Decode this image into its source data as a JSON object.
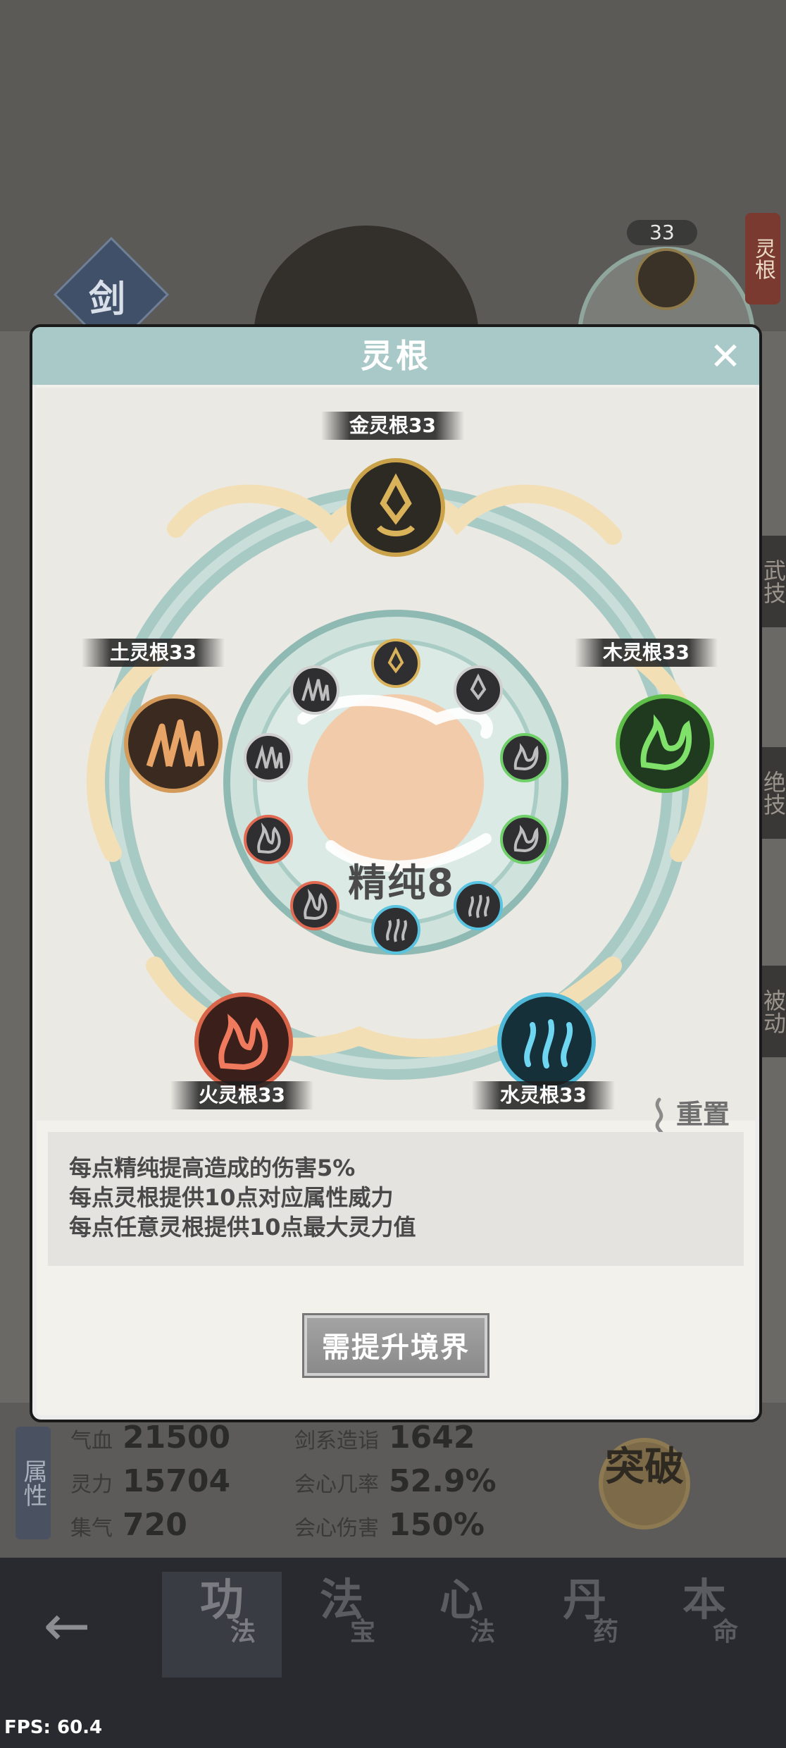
{
  "background": {
    "skill_badge": "剑",
    "level_badge": "33",
    "side_tag": "灵根",
    "side_tabs": [
      "武技",
      "绝技",
      "被动"
    ]
  },
  "modal": {
    "title": "灵根",
    "close_icon": "close-icon",
    "purity_label": "精纯8",
    "roots": {
      "metal": {
        "label": "金灵根33",
        "color": "#c9a24a"
      },
      "wood": {
        "label": "木灵根33",
        "color": "#5fbf4a"
      },
      "water": {
        "label": "水灵根33",
        "color": "#4fb8d6"
      },
      "fire": {
        "label": "火灵根33",
        "color": "#d8644a"
      },
      "earth": {
        "label": "土灵根33",
        "color": "#d39a5a"
      }
    },
    "reset_label": "重置",
    "descriptions": [
      "每点精纯提高造成的伤害5%",
      "每点灵根提供10点对应属性威力",
      "每点任意灵根提供10点最大灵力值"
    ],
    "action_button": "需提升境界"
  },
  "stats": {
    "section_label": "属性",
    "help": "?",
    "hp": {
      "label": "气血",
      "value": "21500"
    },
    "spirit": {
      "label": "灵力",
      "value": "15704"
    },
    "gather": {
      "label": "集气",
      "value": "720"
    },
    "sword": {
      "label": "剑系造诣",
      "value": "1642"
    },
    "crit_rate": {
      "label": "会心几率",
      "value": "52.9%"
    },
    "crit_dmg": {
      "label": "会心伤害",
      "value": "150%"
    },
    "breakthrough": "突破"
  },
  "nav": {
    "back_icon": "back-arrow-icon",
    "items": [
      {
        "big": "功",
        "small": "法",
        "active": true
      },
      {
        "big": "法",
        "small": "宝",
        "active": false
      },
      {
        "big": "心",
        "small": "法",
        "active": false
      },
      {
        "big": "丹",
        "small": "药",
        "active": false
      },
      {
        "big": "本",
        "small": "命",
        "active": false
      }
    ]
  },
  "fps": "FPS: 60.4"
}
